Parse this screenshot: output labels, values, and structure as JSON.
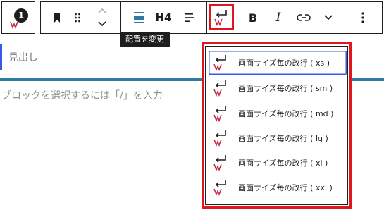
{
  "block_switcher": {
    "badge_number": "1"
  },
  "toolbar": {
    "heading_level": "H4",
    "bold_label": "B",
    "italic_label": "I"
  },
  "tooltip": {
    "text": "配置を変更"
  },
  "editor": {
    "heading_placeholder": "見出し",
    "paragraph_placeholder": "ブロックを選択するには「/」を入力"
  },
  "dropdown": {
    "items": [
      {
        "label": "画面サイズ毎の改行 ( xs )",
        "active": true
      },
      {
        "label": "画面サイズ毎の改行 ( sm )"
      },
      {
        "label": "画面サイズ毎の改行 ( md )"
      },
      {
        "label": "画面サイズ毎の改行 ( lg )"
      },
      {
        "label": "画面サイズ毎の改行 ( xl )"
      },
      {
        "label": "画面サイズ毎の改行 ( xxl )"
      }
    ]
  },
  "colors": {
    "highlight": "#e0151d",
    "accent": "#3858e9",
    "wp_badge": "#c6223e"
  }
}
